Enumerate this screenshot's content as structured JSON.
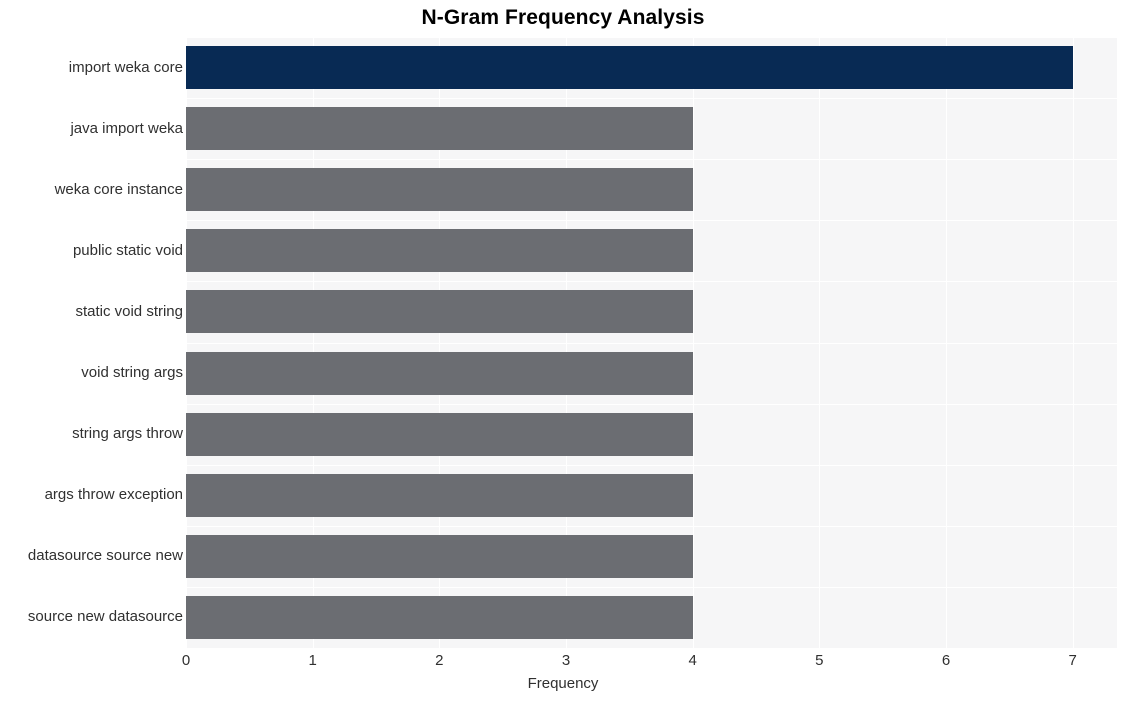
{
  "chart_data": {
    "type": "bar",
    "orientation": "horizontal",
    "title": "N-Gram Frequency Analysis",
    "xlabel": "Frequency",
    "ylabel": "",
    "categories": [
      "import weka core",
      "java import weka",
      "weka core instance",
      "public static void",
      "static void string",
      "void string args",
      "string args throw",
      "args throw exception",
      "datasource source new",
      "source new datasource"
    ],
    "values": [
      7,
      4,
      4,
      4,
      4,
      4,
      4,
      4,
      4,
      4
    ],
    "xlim": [
      0,
      7.35
    ],
    "xticks": [
      0,
      1,
      2,
      3,
      4,
      5,
      6,
      7
    ],
    "xtick_labels": [
      "0",
      "1",
      "2",
      "3",
      "4",
      "5",
      "6",
      "7"
    ],
    "grid": true,
    "legend": false,
    "bar_colors": [
      "#082a54",
      "#6b6d72",
      "#6b6d72",
      "#6b6d72",
      "#6b6d72",
      "#6b6d72",
      "#6b6d72",
      "#6b6d72",
      "#6b6d72",
      "#6b6d72"
    ],
    "highlight_color": "#082a54",
    "default_bar_color": "#6b6d72",
    "plot_background": "#f6f6f7",
    "gridline_color": "#ffffff",
    "figure_background": "#ffffff",
    "text_color": "#303030",
    "title_color": "#000000"
  }
}
